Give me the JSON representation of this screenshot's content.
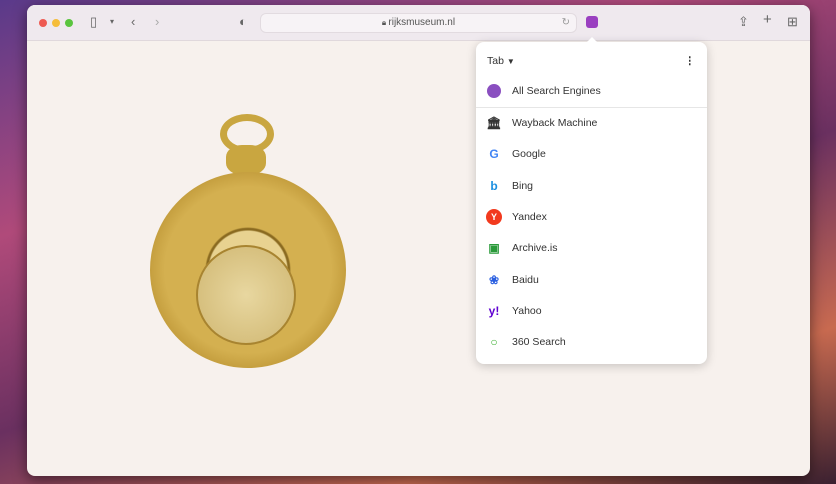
{
  "browser": {
    "url": "rijksmuseum.nl"
  },
  "popup": {
    "mode": "Tab",
    "all": "All Search Engines",
    "engines": [
      {
        "label": "Wayback Machine",
        "icon": "wayback-icon",
        "color": "#333333"
      },
      {
        "label": "Google",
        "icon": "google-icon",
        "color": "#4285f4"
      },
      {
        "label": "Bing",
        "icon": "bing-icon",
        "color": "#1b8fe0"
      },
      {
        "label": "Yandex",
        "icon": "yandex-icon",
        "color": "#f23a1e"
      },
      {
        "label": "Archive.is",
        "icon": "archive-icon",
        "color": "#2a9a3a"
      },
      {
        "label": "Baidu",
        "icon": "baidu-icon",
        "color": "#2a5fe0"
      },
      {
        "label": "Yahoo",
        "icon": "yahoo-icon",
        "color": "#6001d2"
      },
      {
        "label": "360 Search",
        "icon": "360-search-icon",
        "color": "#3ab030"
      }
    ]
  }
}
